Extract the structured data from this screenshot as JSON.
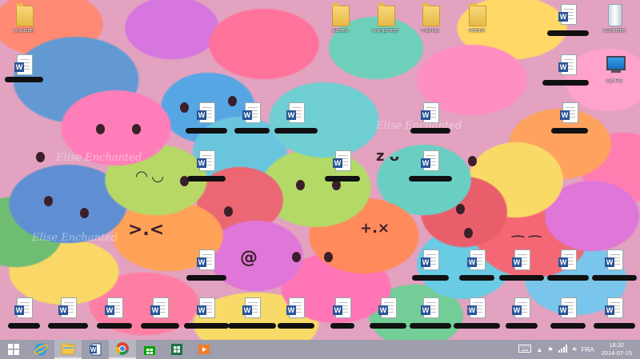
{
  "desktop": {
    "watermark": "Elise Enchanted",
    "icons": [
      {
        "type": "folder",
        "label": "A poster"
      },
      {
        "type": "word",
        "label": ""
      },
      {
        "type": "folder",
        "label": "Autres"
      },
      {
        "type": "folder",
        "label": "A imprimer"
      },
      {
        "type": "folder",
        "label": "Fumus"
      },
      {
        "type": "folder",
        "label": "Forum"
      },
      {
        "type": "word",
        "label": ""
      },
      {
        "type": "recycle",
        "label": "Corbeille"
      },
      {
        "type": "word",
        "label": ""
      },
      {
        "type": "pc",
        "label": "Ce PC"
      }
    ]
  },
  "taskbar": {
    "apps": [
      {
        "name": "start",
        "icon": "windows-logo-icon"
      },
      {
        "name": "internet-explorer",
        "icon": "ie-icon"
      },
      {
        "name": "file-explorer",
        "icon": "folder-icon"
      },
      {
        "name": "word",
        "icon": "word-icon"
      },
      {
        "name": "chrome",
        "icon": "chrome-icon"
      },
      {
        "name": "store",
        "icon": "store-icon"
      },
      {
        "name": "excel",
        "icon": "excel-icon"
      },
      {
        "name": "media",
        "icon": "media-icon"
      }
    ],
    "tray": {
      "language": "FRA",
      "time": "18:32",
      "date": "2014-07-15"
    }
  },
  "colors": {
    "word_blue": "#2a5699",
    "taskbar": "#9696a5",
    "chrome_red": "#db4437"
  }
}
